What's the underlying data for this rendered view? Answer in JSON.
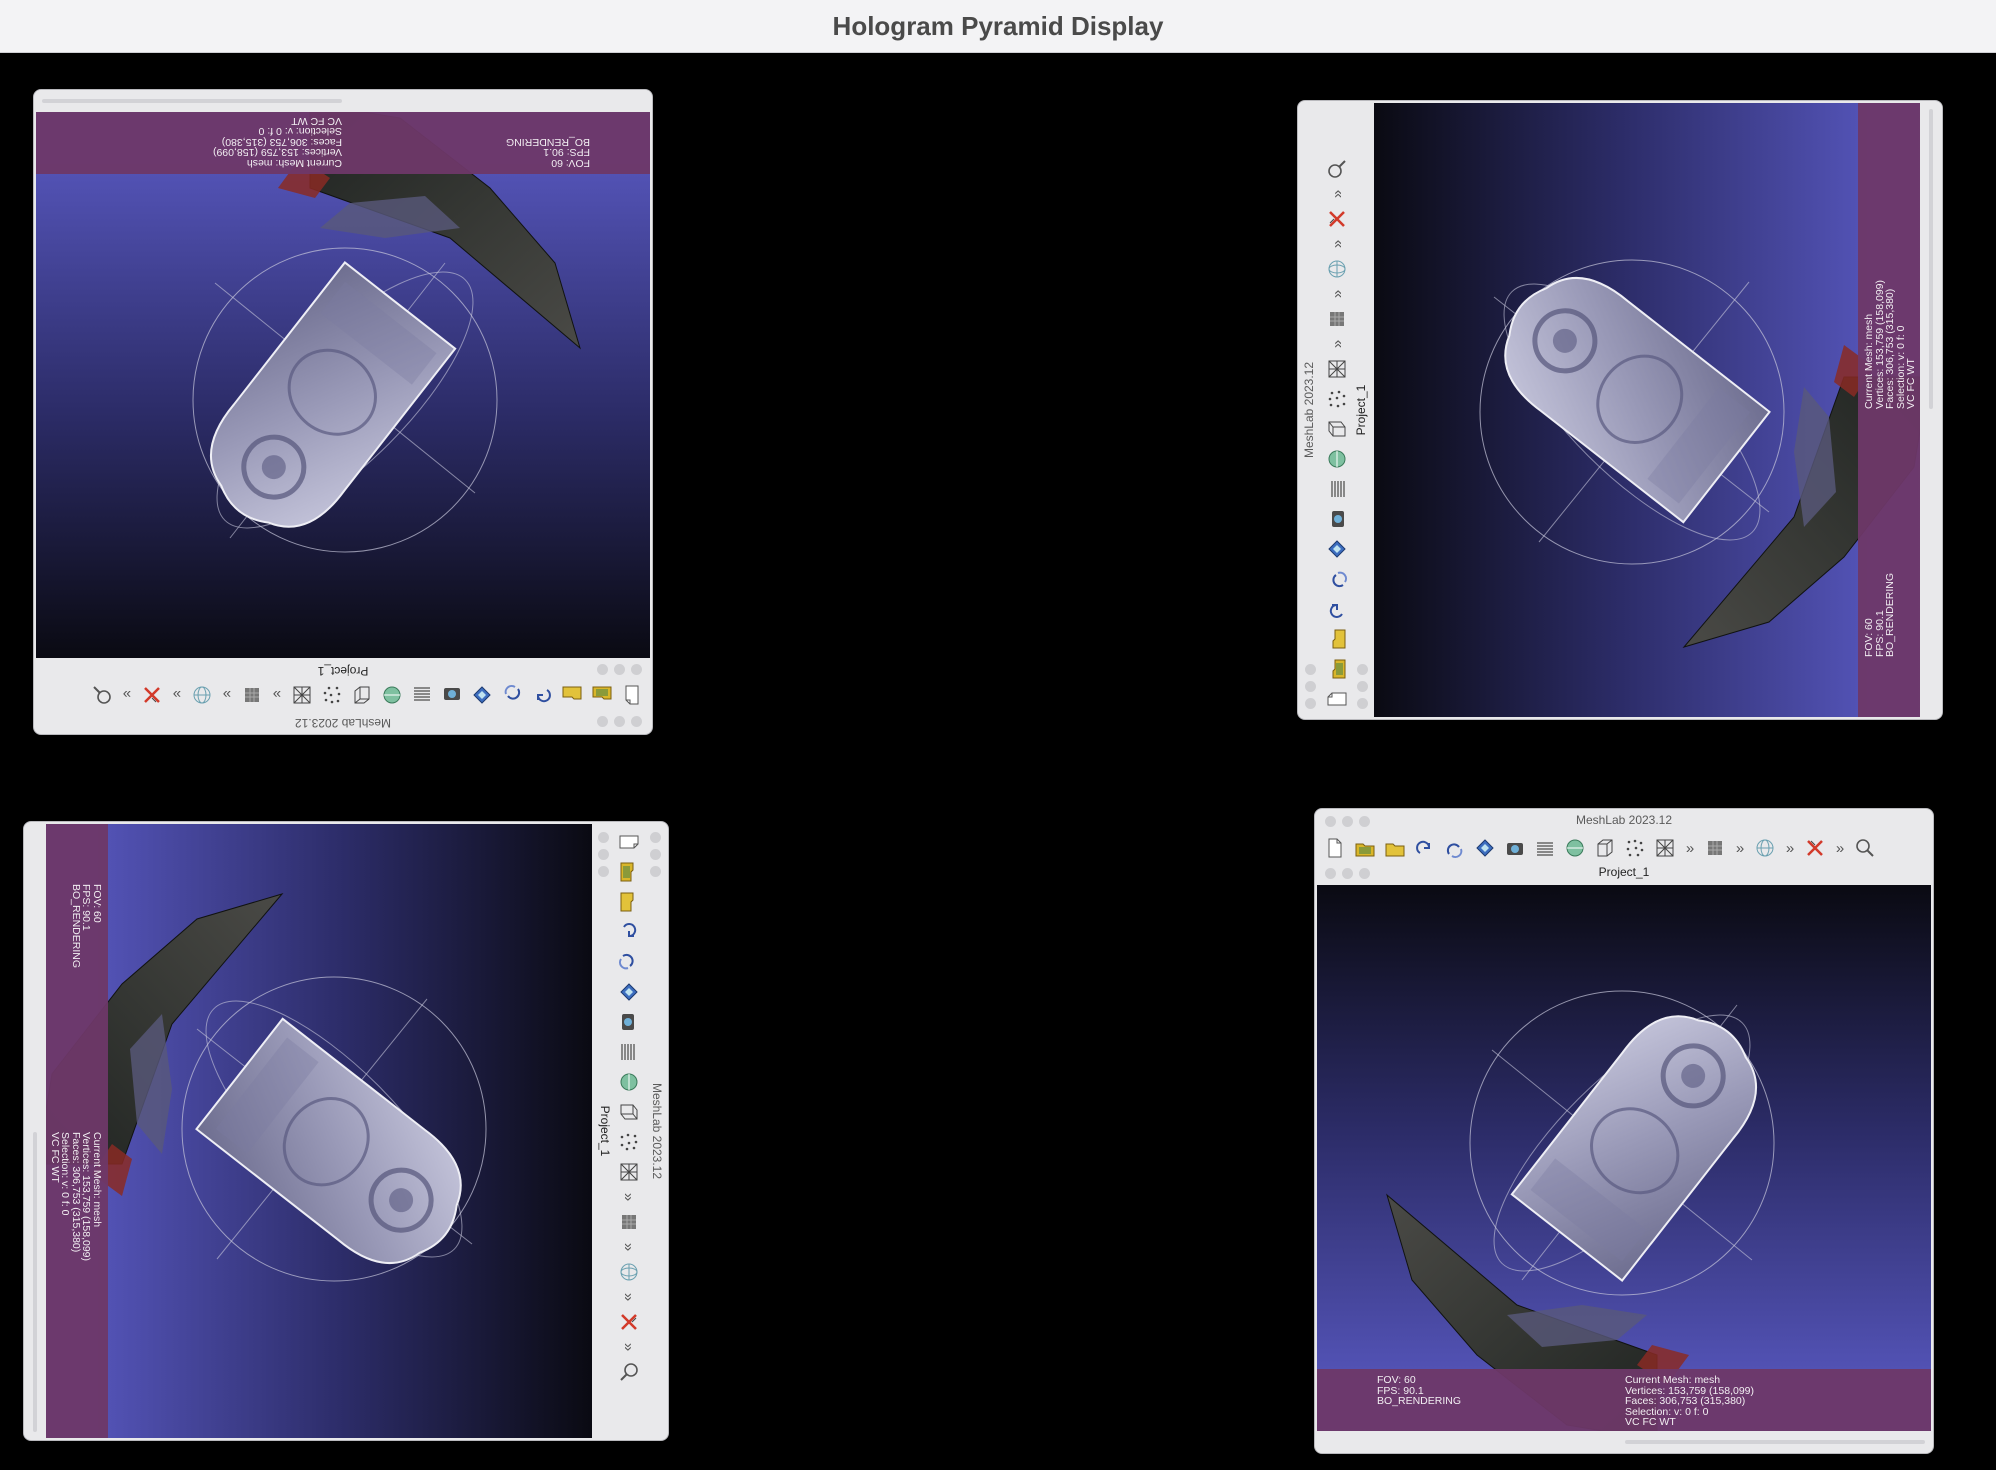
{
  "window_title": "Hologram Pyramid Display",
  "meshlab": {
    "app_title": "MeshLab 2023.12",
    "tab_label": "Project_1",
    "toolbar_icons": [
      "new-file-icon",
      "open-project-icon",
      "open-mesh-icon",
      "reload-icon",
      "reload-all-icon",
      "save-icon",
      "snapshot-icon",
      "layers-icon",
      "texture-icon",
      "bbox-icon",
      "points-icon",
      "wireframe-icon",
      "more-chevron-icon",
      "flat-shading-icon",
      "more-chevron-icon",
      "globe-icon",
      "more-chevron-icon",
      "close-red-icon",
      "more-chevron-icon",
      "search-icon"
    ],
    "info_left": {
      "fov": "FOV: 60",
      "fps": "FPS:    90.1",
      "mode": "BO_RENDERING"
    },
    "info_right": {
      "mesh": "Current Mesh: mesh",
      "vertices": "Vertices: 153,759    (158,099)",
      "faces": "Faces: 306,753    (315,380)",
      "selection": "Selection: v: 0 f: 0",
      "flags": "VC FC WT"
    }
  },
  "colors": {
    "info_panel": "#6e3868",
    "viewport_bottom": "#5c5cc8",
    "viewport_top": "#0a0a12",
    "titlebar_bg": "#f3f3f5"
  }
}
